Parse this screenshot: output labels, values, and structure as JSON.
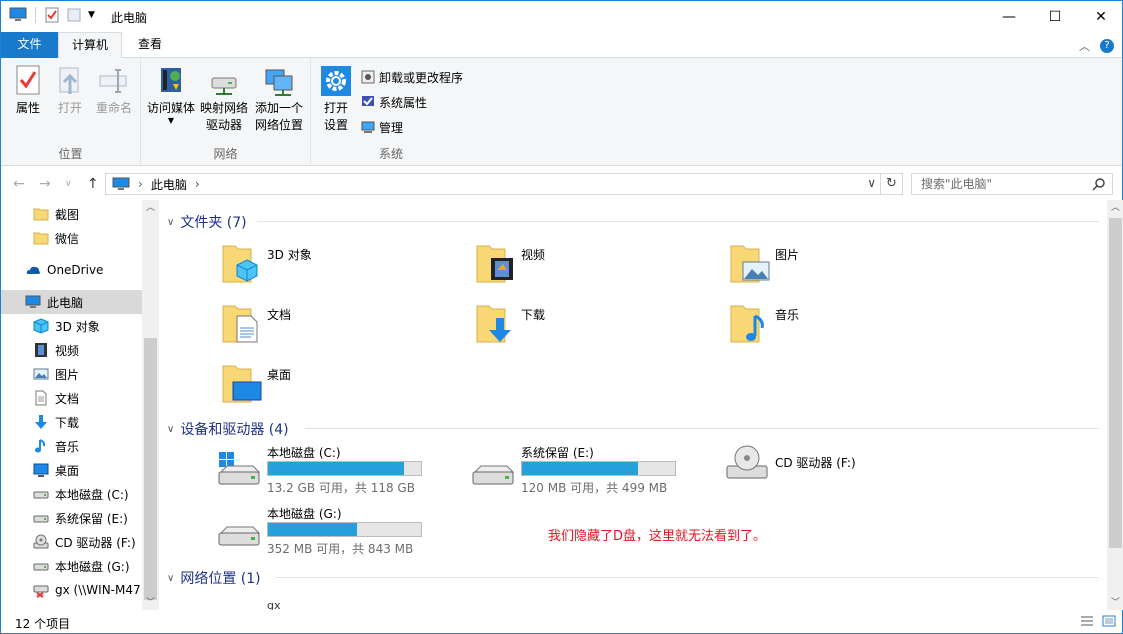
{
  "window": {
    "title": "此电脑"
  },
  "ribbon": {
    "tabs": [
      "文件",
      "计算机",
      "查看"
    ],
    "groups": {
      "location": {
        "label": "位置",
        "buttons": [
          "属性",
          "打开",
          "重命名"
        ]
      },
      "network": {
        "label": "网络",
        "buttons": [
          "访问媒体",
          "映射网络\n驱动器",
          "添加一个\n网络位置"
        ]
      },
      "system": {
        "label": "系统",
        "open_settings": "打开\n设置",
        "items": [
          "卸载或更改程序",
          "系统属性",
          "管理"
        ]
      }
    }
  },
  "address": {
    "path": "此电脑",
    "search_placeholder": "搜索\"此电脑\""
  },
  "nav": {
    "items": [
      {
        "label": "截图",
        "icon": "folder-icon"
      },
      {
        "label": "微信",
        "icon": "folder-icon"
      },
      {
        "label": "OneDrive",
        "icon": "onedrive-icon"
      },
      {
        "label": "此电脑",
        "icon": "computer-icon"
      },
      {
        "label": "3D 对象",
        "icon": "3d-objects-icon"
      },
      {
        "label": "视频",
        "icon": "video-icon"
      },
      {
        "label": "图片",
        "icon": "pictures-icon"
      },
      {
        "label": "文档",
        "icon": "documents-icon"
      },
      {
        "label": "下载",
        "icon": "download-icon"
      },
      {
        "label": "音乐",
        "icon": "music-icon"
      },
      {
        "label": "桌面",
        "icon": "desktop-icon"
      },
      {
        "label": "本地磁盘 (C:)",
        "icon": "drive-icon"
      },
      {
        "label": "系统保留 (E:)",
        "icon": "drive-icon"
      },
      {
        "label": "CD 驱动器 (F:)",
        "icon": "cd-drive-icon"
      },
      {
        "label": "本地磁盘 (G:)",
        "icon": "drive-icon"
      },
      {
        "label": "gx (\\\\WIN-M47",
        "icon": "network-drive-icon"
      }
    ]
  },
  "content": {
    "sections": {
      "folders": "文件夹 (7)",
      "devices": "设备和驱动器 (4)",
      "network": "网络位置 (1)"
    },
    "folders": [
      {
        "name": "3D 对象",
        "icon": "3d-objects-icon"
      },
      {
        "name": "视频",
        "icon": "video-icon"
      },
      {
        "name": "图片",
        "icon": "pictures-icon"
      },
      {
        "name": "文档",
        "icon": "documents-icon"
      },
      {
        "name": "下载",
        "icon": "download-icon"
      },
      {
        "name": "音乐",
        "icon": "music-icon"
      },
      {
        "name": "桌面",
        "icon": "desktop-icon"
      }
    ],
    "drives": [
      {
        "name": "本地磁盘 (C:)",
        "free": "13.2 GB 可用，共 118 GB",
        "used_fraction": 0.89,
        "icon": "windows-drive-icon"
      },
      {
        "name": "系统保留 (E:)",
        "free": "120 MB 可用，共 499 MB",
        "used_fraction": 0.76,
        "icon": "drive-icon"
      },
      {
        "name": "CD 驱动器 (F:)",
        "free": "",
        "icon": "cd-drive-icon"
      },
      {
        "name": "本地磁盘 (G:)",
        "free": "352 MB 可用，共 843 MB",
        "used_fraction": 0.58,
        "icon": "drive-icon"
      }
    ],
    "network_partial": "gx",
    "note": "我们隐藏了D盘，这里就无法看到了。"
  },
  "status": {
    "count": "12 个项目"
  },
  "colors": {
    "accent": "#1979ca",
    "section": "#1e3287",
    "bar": "#26a0da",
    "note": "#e81123"
  }
}
